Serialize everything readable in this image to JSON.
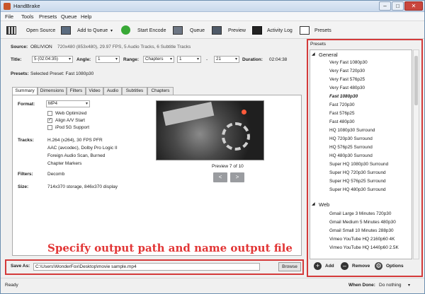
{
  "window": {
    "title": "HandBrake"
  },
  "menu": [
    "File",
    "Tools",
    "Presets",
    "Queue",
    "Help"
  ],
  "toolbar": {
    "open_source": "Open Source",
    "add_to_queue": "Add to Queue",
    "start_encode": "Start Encode",
    "queue": "Queue",
    "preview": "Preview",
    "activity_log": "Activity Log",
    "presets": "Presets"
  },
  "source": {
    "label": "Source:",
    "value": "OBLIVION",
    "info": "720x480 (853x480), 29.97 FPS, 5 Audio Tracks, 6 Subtitle Tracks"
  },
  "title_row": {
    "title_label": "Title:",
    "title_value": "5 (02:04:35)",
    "angle_label": "Angle:",
    "angle_value": "1",
    "range_label": "Range:",
    "range_type": "Chapters",
    "range_start": "1",
    "range_sep": "-",
    "range_end": "21",
    "duration_label": "Duration:",
    "duration_value": "02:04:38"
  },
  "presets_row": {
    "label": "Presets:",
    "value": "Selected Preset: Fast 1080p30"
  },
  "tabs": [
    "Summary",
    "Dimensions",
    "Filters",
    "Video",
    "Audio",
    "Subtitles",
    "Chapters"
  ],
  "summary": {
    "format_label": "Format:",
    "format_value": "MP4",
    "web_optimized": "Web Optimized",
    "align_av": "Align A/V Start",
    "ipod": "iPod 5G Support",
    "tracks_label": "Tracks:",
    "tracks": [
      "H.264 (x264), 30 FPS PFR",
      "AAC (avcodec), Dolby Pro Logic II",
      "Foreign Audio Scan, Burned",
      "Chapter Markers"
    ],
    "filters_label": "Filters:",
    "filters_value": "Decomb",
    "size_label": "Size:",
    "size_value": "714x370 storage, 846x370 display",
    "preview_caption": "Preview 7 of 10",
    "prev_btn": "<",
    "next_btn": ">"
  },
  "annotation": "Specify output path and name output file",
  "save": {
    "label": "Save As:",
    "path": "C:\\Users\\WonderFox\\Desktop\\movie sample.mp4",
    "browse": "Browse"
  },
  "status": {
    "ready": "Ready",
    "when_done_label": "When Done:",
    "when_done_value": "Do nothing"
  },
  "presets_panel": {
    "header": "Presets",
    "groups": [
      {
        "name": "General",
        "items": [
          "Very Fast 1080p30",
          "Very Fast 720p30",
          "Very Fast 576p25",
          "Very Fast 480p30",
          "Fast 1080p30",
          "Fast 720p30",
          "Fast 576p25",
          "Fast 480p30",
          "HQ 1080p30 Surround",
          "HQ 720p30 Surround",
          "HQ 576p25 Surround",
          "HQ 480p30 Surround",
          "Super HQ 1080p30 Surround",
          "Super HQ 720p30 Surround",
          "Super HQ 576p25 Surround",
          "Super HQ 480p30 Surround"
        ]
      },
      {
        "name": "Web",
        "items": [
          "Gmail Large 3 Minutes 720p30",
          "Gmail Medium 5 Minutes 480p30",
          "Gmail Small 10 Minutes 288p30",
          "Vimeo YouTube HQ 2160p60 4K",
          "Vimeo YouTube HQ 1440p60 2.5K"
        ]
      }
    ],
    "selected": "Fast 1080p30",
    "add": "Add",
    "remove": "Remove",
    "options": "Options"
  },
  "colors": {
    "highlight_border": "#d43a3a",
    "annotation_text": "#e23636"
  }
}
